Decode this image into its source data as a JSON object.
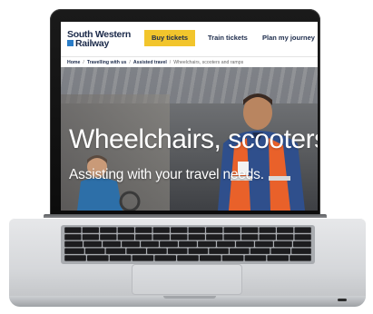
{
  "site": {
    "logo_line1": "South Western",
    "logo_line2": "Railway",
    "buy_tickets": "Buy tickets",
    "train_tickets": "Train tickets",
    "plan_journey": "Plan my journey"
  },
  "breadcrumb": {
    "home": "Home",
    "travelling": "Travelling with us",
    "assisted": "Assisted travel",
    "current": "Wheelchairs, scooters and ramps",
    "separator": "/"
  },
  "hero": {
    "title": "Wheelchairs, scooters",
    "subtitle": "Assisting with your travel needs."
  },
  "colors": {
    "brand_navy": "#1b2a4a",
    "button_yellow": "#f2c52c",
    "hi_vis_orange": "#e9612a"
  }
}
